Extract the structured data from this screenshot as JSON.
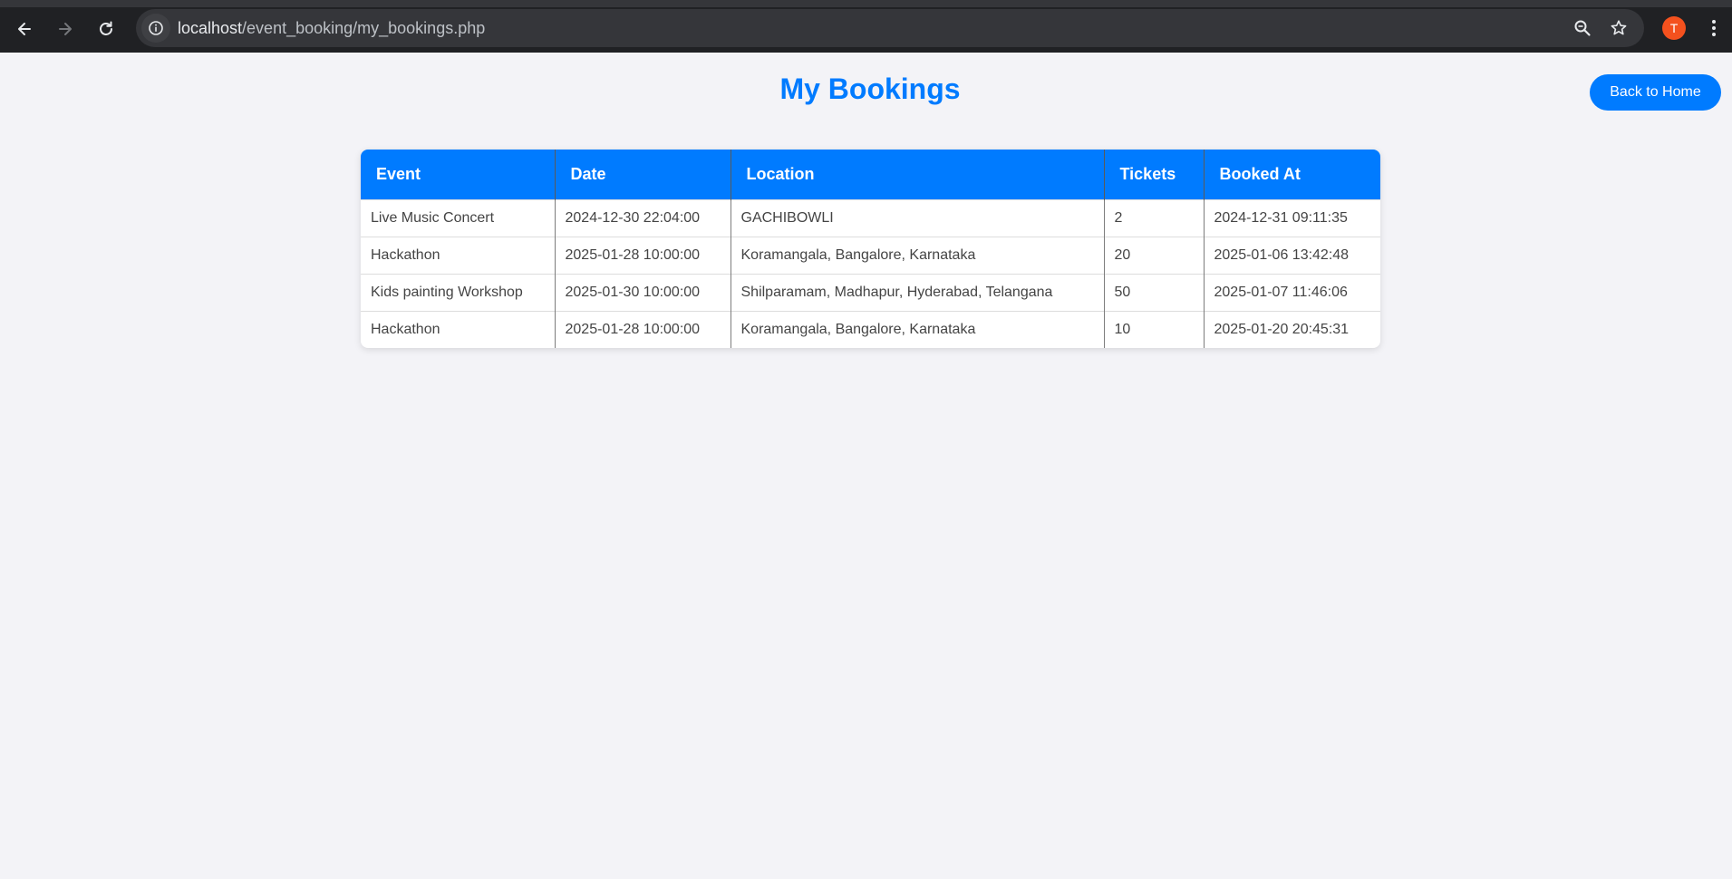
{
  "browser": {
    "url_host": "localhost",
    "url_path": "/event_booking/my_bookings.php",
    "avatar_initial": "T"
  },
  "page": {
    "title": "My Bookings",
    "back_button": "Back to Home"
  },
  "table": {
    "headers": [
      "Event",
      "Date",
      "Location",
      "Tickets",
      "Booked At"
    ],
    "rows": [
      [
        "Live Music Concert",
        "2024-12-30 22:04:00",
        "GACHIBOWLI",
        "2",
        "2024-12-31 09:11:35"
      ],
      [
        "Hackathon",
        "2025-01-28 10:00:00",
        "Koramangala, Bangalore, Karnataka",
        "20",
        "2025-01-06 13:42:48"
      ],
      [
        "Kids painting Workshop",
        "2025-01-30 10:00:00",
        "Shilparamam, Madhapur, Hyderabad, Telangana",
        "50",
        "2025-01-07 11:46:06"
      ],
      [
        "Hackathon",
        "2025-01-28 10:00:00",
        "Koramangala, Bangalore, Karnataka",
        "10",
        "2025-01-20 20:45:31"
      ]
    ]
  },
  "colors": {
    "accent": "#007bff",
    "page_background": "#f3f3f7",
    "avatar": "#f4511e"
  },
  "icons": [
    "back-arrow-icon",
    "forward-arrow-icon",
    "reload-icon",
    "info-icon",
    "zoom-icon",
    "bookmark-star-icon",
    "more-vert-icon"
  ]
}
